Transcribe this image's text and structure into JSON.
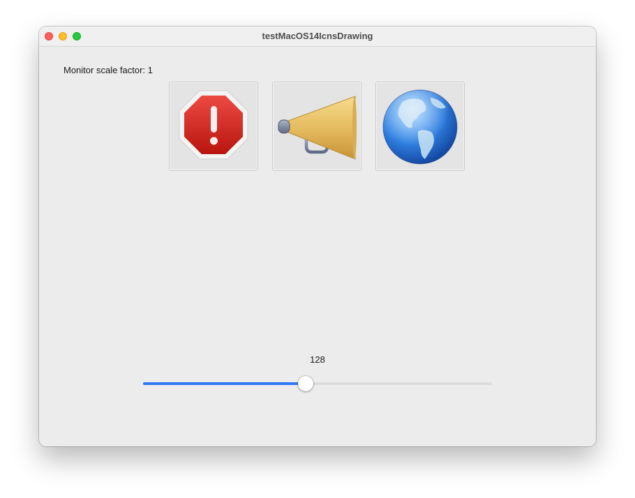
{
  "window": {
    "title": "testMacOS14IcnsDrawing"
  },
  "content": {
    "scale_label": "Monitor scale factor: 1",
    "icons": [
      {
        "name": "alert-stop-icon"
      },
      {
        "name": "megaphone-icon"
      },
      {
        "name": "globe-icon"
      }
    ]
  },
  "slider": {
    "value_label": "128",
    "fraction": 0.466
  },
  "colors": {
    "accent": "#3478f6",
    "close": "#fe5f57",
    "minimize": "#febc2e",
    "zoom": "#28c840"
  }
}
